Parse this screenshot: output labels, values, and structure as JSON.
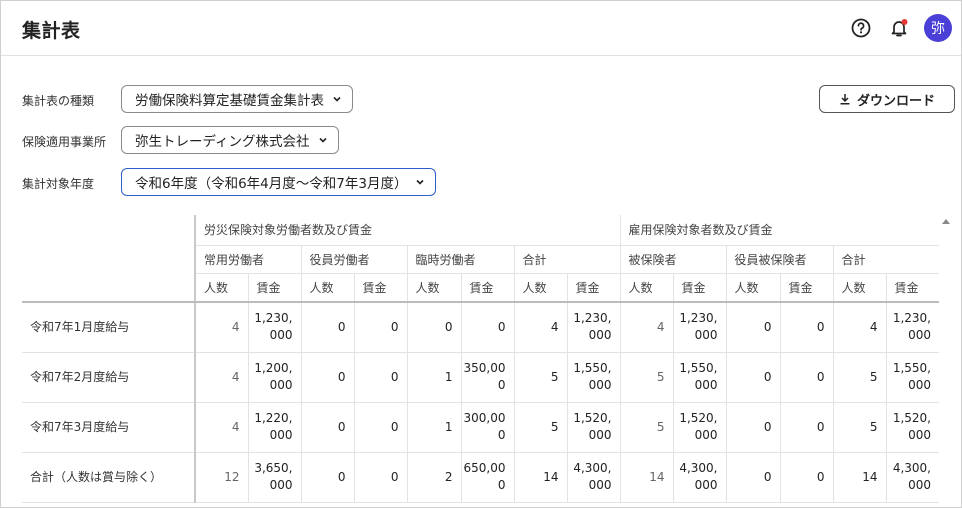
{
  "header": {
    "title": "集計表",
    "avatar_text": "弥"
  },
  "icons": {
    "help": "help-circle-icon",
    "bell": "bell-icon",
    "download": "download-icon",
    "chevron": "chevron-down-icon"
  },
  "colors": {
    "accent": "#4a3fd6",
    "focus": "#2c5fc9",
    "notification": "#e53935"
  },
  "filters": {
    "type_label": "集計表の種類",
    "type_value": "労働保険料算定基礎賃金集計表",
    "office_label": "保険適用事業所",
    "office_value": "弥生トレーディング株式会社",
    "year_label": "集計対象年度",
    "year_value": "令和6年度（令和6年4月度〜令和7年3月度）"
  },
  "download_label": "ダウンロード",
  "table": {
    "groups": [
      "労災保険対象労働者数及び賃金",
      "雇用保険対象者数及び賃金"
    ],
    "subgroups": [
      "常用労働者",
      "役員労働者",
      "臨時労働者",
      "合計",
      "被保険者",
      "役員被保険者",
      "合計"
    ],
    "subheads": [
      "人数",
      "賃金",
      "人数",
      "賃金",
      "人数",
      "賃金",
      "人数",
      "賃金",
      "人数",
      "賃金",
      "人数",
      "賃金",
      "人数",
      "賃金"
    ],
    "rows": [
      {
        "label": "令和7年1月度給与",
        "cells": [
          "4",
          "1,230,\n000",
          "0",
          "0",
          "0",
          "0",
          "4",
          "1,230,\n000",
          "4",
          "1,230,\n000",
          "0",
          "0",
          "4",
          "1,230,\n000"
        ]
      },
      {
        "label": "令和7年2月度給与",
        "cells": [
          "4",
          "1,200,\n000",
          "0",
          "0",
          "1",
          "350,00\n0",
          "5",
          "1,550,\n000",
          "5",
          "1,550,\n000",
          "0",
          "0",
          "5",
          "1,550,\n000"
        ]
      },
      {
        "label": "令和7年3月度給与",
        "cells": [
          "4",
          "1,220,\n000",
          "0",
          "0",
          "1",
          "300,00\n0",
          "5",
          "1,520,\n000",
          "5",
          "1,520,\n000",
          "0",
          "0",
          "5",
          "1,520,\n000"
        ]
      },
      {
        "label": "合計（人数は賞与除く）",
        "cells": [
          "12",
          "3,650,\n000",
          "0",
          "0",
          "2",
          "650,00\n0",
          "14",
          "4,300,\n000",
          "14",
          "4,300,\n000",
          "0",
          "0",
          "14",
          "4,300,\n000"
        ]
      }
    ]
  }
}
